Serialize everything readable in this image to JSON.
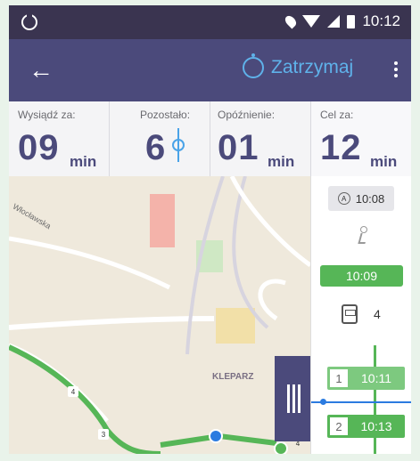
{
  "status_bar": {
    "time": "10:12"
  },
  "app_bar": {
    "stop_label": "Zatrzymaj"
  },
  "stats": [
    {
      "label": "Wysiądź za:",
      "value": "09",
      "unit": "min"
    },
    {
      "label": "Pozostało:",
      "value": "6",
      "unit": ""
    },
    {
      "label": "Opóźnienie:",
      "value": "01",
      "unit": "min"
    },
    {
      "label": "Cel za:",
      "value": "12",
      "unit": "min"
    }
  ],
  "map": {
    "district_label": "KLEPARZ",
    "street_label": "Włocławska",
    "route_numbers": [
      "4",
      "3"
    ]
  },
  "panel": {
    "start_time": "10:08",
    "bus_time": "10:09",
    "bus_number": "4",
    "stops": [
      {
        "index": "1",
        "time": "10:11"
      },
      {
        "index": "2",
        "time": "10:13"
      }
    ],
    "map_bus_number": "4"
  },
  "colors": {
    "status_bar": "#3a3450",
    "app_bar": "#4b4a7b",
    "accent_blue": "#5fb2ea",
    "route_green": "#56b657"
  }
}
